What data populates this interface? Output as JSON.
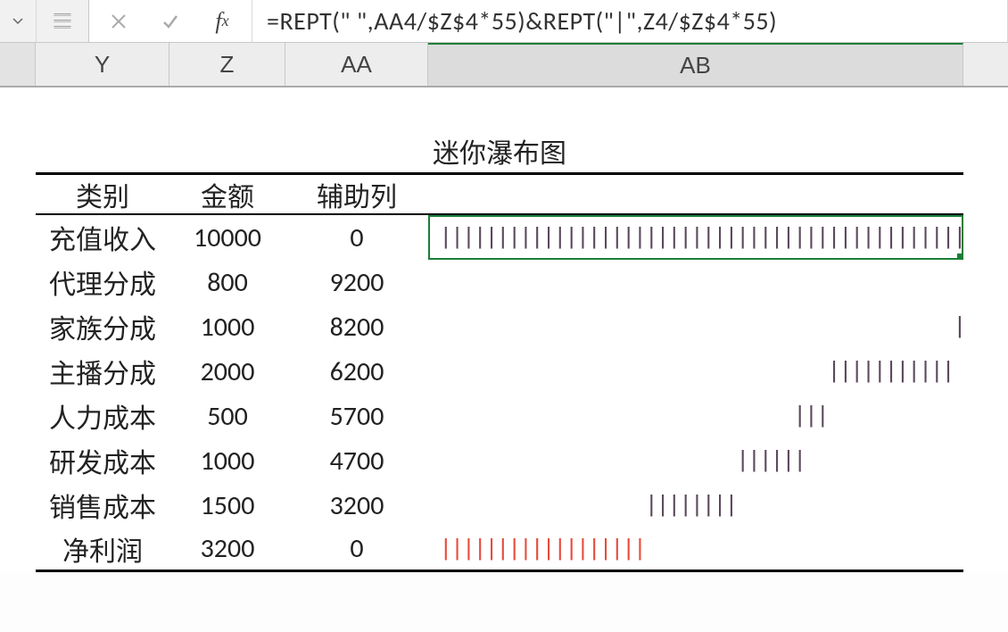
{
  "formula_bar": {
    "formula": "=REPT(\" \",AA4/$Z$4*55)&REPT(\"|\",Z4/$Z$4*55)"
  },
  "columns": {
    "y": "Y",
    "z": "Z",
    "aa": "AA",
    "ab": "AB"
  },
  "table": {
    "title": "迷你瀑布图",
    "headers": {
      "category": "类别",
      "amount": "金额",
      "aux": "辅助列"
    }
  },
  "chart_data": {
    "type": "bar",
    "title": "迷你瀑布图",
    "series_base": 10000,
    "rows": [
      {
        "category": "充值收入",
        "amount": 10000,
        "aux": 0,
        "color": "dark",
        "selected": true
      },
      {
        "category": "代理分成",
        "amount": 800,
        "aux": 9200,
        "color": "dark"
      },
      {
        "category": "家族分成",
        "amount": 1000,
        "aux": 8200,
        "color": "dark"
      },
      {
        "category": "主播分成",
        "amount": 2000,
        "aux": 6200,
        "color": "dark"
      },
      {
        "category": "人力成本",
        "amount": 500,
        "aux": 5700,
        "color": "dark"
      },
      {
        "category": "研发成本",
        "amount": 1000,
        "aux": 4700,
        "color": "dark"
      },
      {
        "category": "销售成本",
        "amount": 1500,
        "aux": 3200,
        "color": "dark"
      },
      {
        "category": "净利润",
        "amount": 3200,
        "aux": 0,
        "color": "red"
      }
    ]
  }
}
